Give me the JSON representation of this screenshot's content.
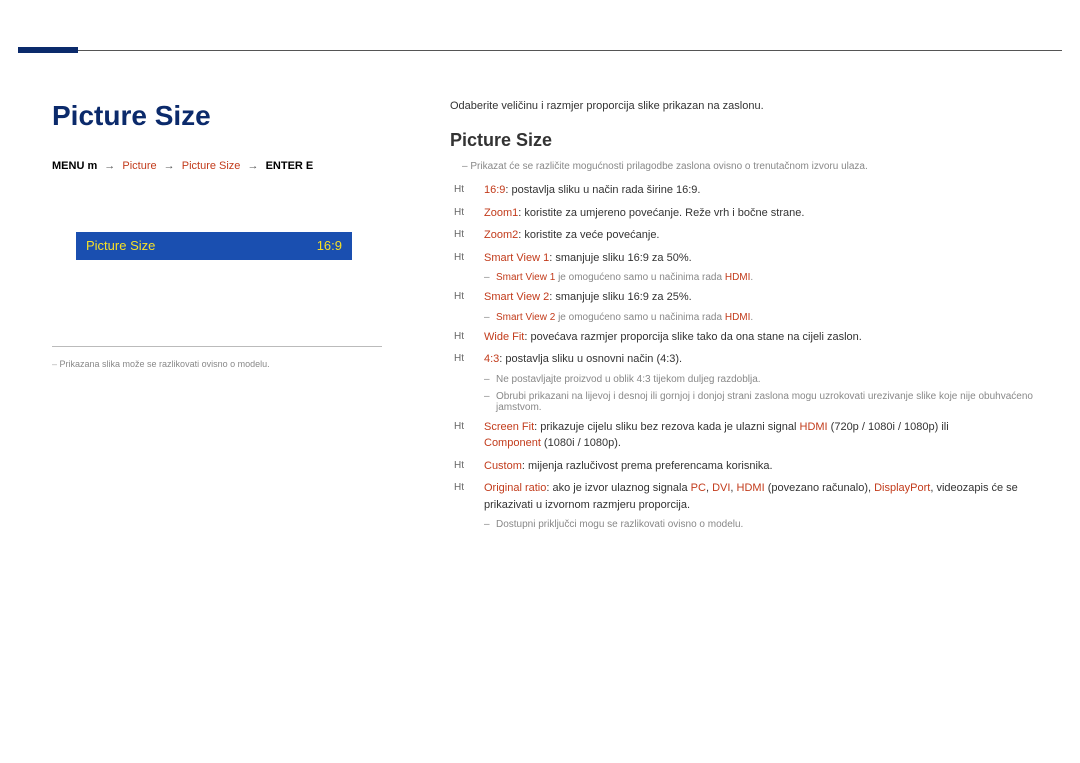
{
  "left": {
    "title": "Picture Size",
    "breadcrumb": {
      "menu": "MENU",
      "menu_icon": "m",
      "p1": "Picture",
      "p2": "Picture Size",
      "enter": "ENTER",
      "enter_icon": "E"
    },
    "menu_row_label": "Picture Size",
    "menu_row_value": "16:9",
    "note": "Prikazana slika može se razlikovati ovisno o modelu."
  },
  "right": {
    "intro": "Odaberite veličinu i razmjer proporcija slike prikazan na zaslonu.",
    "section_title": "Picture Size",
    "top_note": "Prikazat će se različite mogućnosti prilagodbe zaslona ovisno o trenutačnom izvoru ulaza.",
    "items": [
      {
        "name": "16:9",
        "text": ": postavlja sliku u način rada širine 16:9."
      },
      {
        "name": "Zoom1",
        "text": ": koristite za umjereno povećanje. Reže vrh i bočne strane."
      },
      {
        "name": "Zoom2",
        "text": ": koristite za veće povećanje."
      },
      {
        "name": "Smart View 1",
        "text": ": smanjuje sliku 16:9 za 50%.",
        "sub": {
          "name": "Smart View 1",
          "mid": " je omogućeno samo u načinima rada ",
          "tail": "HDMI",
          "after": "."
        }
      },
      {
        "name": "Smart View 2",
        "text": ": smanjuje sliku 16:9 za 25%.",
        "sub": {
          "name": "Smart View 2",
          "mid": " je omogućeno samo u načinima rada ",
          "tail": "HDMI",
          "after": "."
        }
      },
      {
        "name": "Wide Fit",
        "text": ": povećava razmjer proporcija slike tako da ona stane na cijeli zaslon."
      },
      {
        "name": "4:3",
        "text": ": postavlja sliku u osnovni način (4:3).",
        "sub_plain": "Ne postavljajte proizvod u oblik 4:3 tijekom duljeg razdoblja.\nObrubi prikazani na lijevoj i desnoj ili gornjoj i donjoj strani zaslona mogu uzrokovati urezivanje slike koje nije obuhvaćeno jamstvom."
      },
      {
        "name": "Screen Fit",
        "text_pre": ": prikazuje cijelu sliku bez rezova kada je ulazni signal ",
        "hdmi": "HDMI",
        "hdmi_suffix": " (720p / 1080i / 1080p) ili",
        "comp": "Component",
        "comp_suffix": " (1080i / 1080p)."
      },
      {
        "name": "Custom",
        "text": ": mijenja razlučivost prema preferencama korisnika."
      },
      {
        "name": "Original ratio",
        "text_pre": ": ako je izvor ulaznog signala ",
        "pc": "PC",
        "dvi": "DVI",
        "hdmi": "HDMI",
        "hdmi_note": " (povezano računalo), ",
        "dp": "DisplayPort",
        "tail": ", videozapis će se prikazivati u izvornom razmjeru proporcija.",
        "sub_plain": "Dostupni priključci mogu se razlikovati ovisno o modelu."
      }
    ]
  }
}
